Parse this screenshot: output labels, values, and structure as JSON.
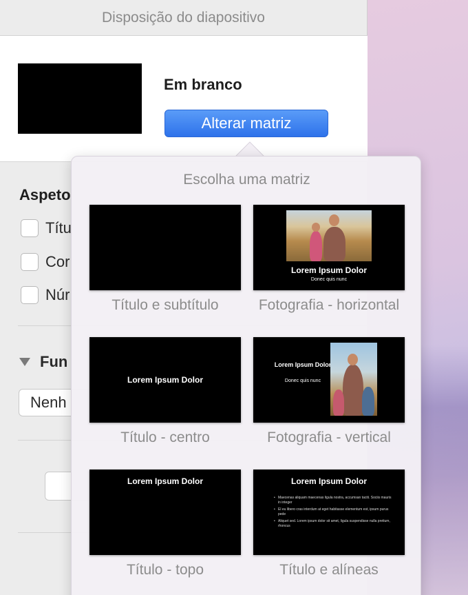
{
  "panel": {
    "header_title": "Disposição do diapositivo",
    "layout_name": "Em branco",
    "change_master_label": "Alterar matriz",
    "appearance_section": "Aspeto",
    "checkboxes": [
      "Títu",
      "Cor",
      "Núr"
    ],
    "disclosure_label": "Fun",
    "select_value": "Nenh"
  },
  "popover": {
    "title": "Escolha uma matriz",
    "masters": [
      {
        "label": "Título e subtítulo"
      },
      {
        "label": "Fotografia - horizontal",
        "title": "Lorem Ipsum Dolor",
        "subtitle": "Donec quis nunc"
      },
      {
        "label": "Título - centro",
        "title": "Lorem Ipsum Dolor"
      },
      {
        "label": "Fotografia - vertical",
        "title": "Lorem Ipsum Dolor",
        "subtitle": "Donec quis nunc"
      },
      {
        "label": "Título - topo",
        "title": "Lorem Ipsum Dolor"
      },
      {
        "label": "Título e alíneas",
        "title": "Lorem Ipsum Dolor",
        "bullets": [
          "Maecenas aliquam maecenas ligula nostra, accumsan taciti. Sociis mauris in integer",
          "El eu libero cras interdum at eget habitasse elementum est, ipsum purus pede",
          "Aliquet sed. Lorem ipsum dolor sit amet, ligula suspendisse nulla pretium, rhoncus"
        ]
      }
    ]
  },
  "colors": {
    "accent": "#2e72ea",
    "panel_bg": "#ececec",
    "popover_bg": "#f3eff5"
  }
}
